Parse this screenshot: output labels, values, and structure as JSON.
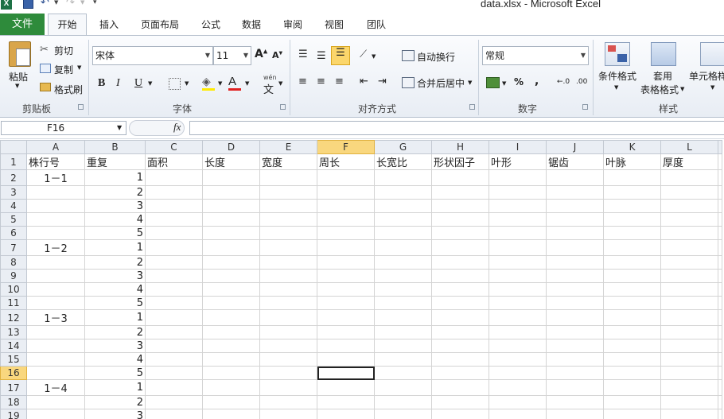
{
  "window": {
    "title": "data.xlsx  -  Microsoft Excel",
    "app_icon": "X"
  },
  "quick_access": {
    "save_icon": "save-icon",
    "undo_icon": "undo-icon",
    "redo_icon": "redo-icon"
  },
  "tabs": {
    "file": "文件",
    "home": "开始",
    "insert": "插入",
    "page_layout": "页面布局",
    "formulas": "公式",
    "data": "数据",
    "review": "审阅",
    "view": "视图",
    "team": "团队"
  },
  "clipboard": {
    "paste": "粘贴",
    "cut": "剪切",
    "copy": "复制",
    "format_painter": "格式刷",
    "group": "剪贴板"
  },
  "font": {
    "name": "宋体",
    "size": "11",
    "group": "字体",
    "bold": "B",
    "italic": "I",
    "underline": "U",
    "wen": "wén",
    "wen_char": "文"
  },
  "alignment": {
    "wrap_text": "自动换行",
    "merge_center": "合并后居中",
    "group": "对齐方式"
  },
  "number": {
    "format": "常规",
    "percent": "%",
    "comma": ",",
    "group": "数字"
  },
  "styles": {
    "conditional": "条件格式",
    "table_format_1": "套用",
    "table_format_2": "表格格式",
    "cell_styles": "单元格样",
    "group": "样式"
  },
  "formula_bar": {
    "name_box": "F16",
    "fx": "fx",
    "value": ""
  },
  "sheet": {
    "columns": [
      "A",
      "B",
      "C",
      "D",
      "E",
      "F",
      "G",
      "H",
      "I",
      "J",
      "K",
      "L"
    ],
    "selected_column": "F",
    "selected_row": "16",
    "active_cell": "F16",
    "header_row": [
      "株行号",
      "重复",
      "面积",
      "长度",
      "宽度",
      "周长",
      "长宽比",
      "形状因子",
      "叶形",
      "锯齿",
      "叶脉",
      "厚度"
    ],
    "rows": [
      {
        "n": "2",
        "a": "1－1",
        "b": "1"
      },
      {
        "n": "3",
        "a": "",
        "b": "2"
      },
      {
        "n": "4",
        "a": "",
        "b": "3"
      },
      {
        "n": "5",
        "a": "",
        "b": "4"
      },
      {
        "n": "6",
        "a": "",
        "b": "5"
      },
      {
        "n": "7",
        "a": "1－2",
        "b": "1"
      },
      {
        "n": "8",
        "a": "",
        "b": "2"
      },
      {
        "n": "9",
        "a": "",
        "b": "3"
      },
      {
        "n": "10",
        "a": "",
        "b": "4"
      },
      {
        "n": "11",
        "a": "",
        "b": "5"
      },
      {
        "n": "12",
        "a": "1－3",
        "b": "1"
      },
      {
        "n": "13",
        "a": "",
        "b": "2"
      },
      {
        "n": "14",
        "a": "",
        "b": "3"
      },
      {
        "n": "15",
        "a": "",
        "b": "4"
      },
      {
        "n": "16",
        "a": "",
        "b": "5"
      },
      {
        "n": "17",
        "a": "1－4",
        "b": "1"
      },
      {
        "n": "18",
        "a": "",
        "b": "2"
      },
      {
        "n": "19",
        "a": "",
        "b": "3"
      }
    ]
  }
}
